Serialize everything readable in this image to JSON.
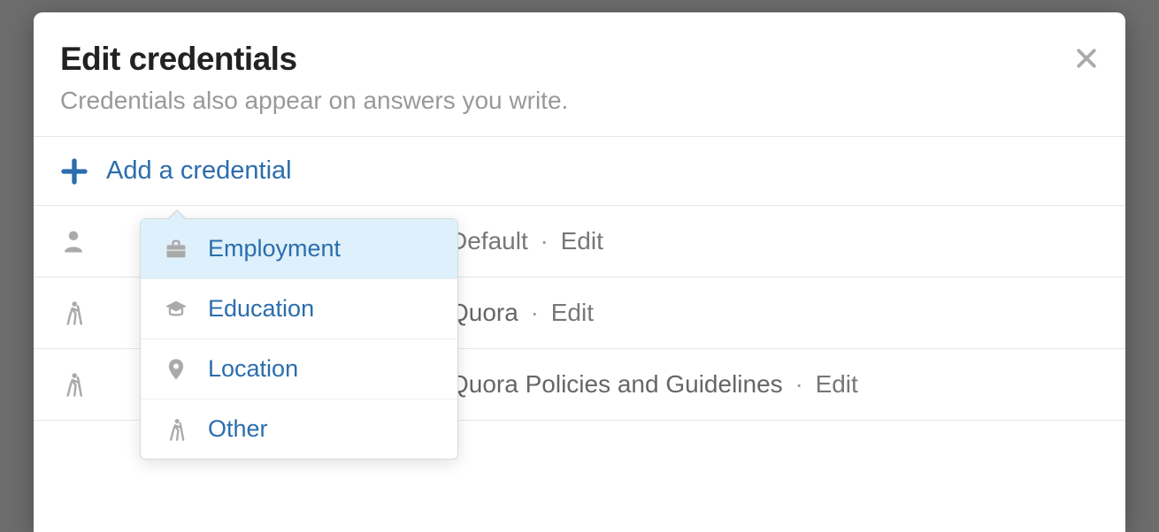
{
  "modal": {
    "title": "Edit credentials",
    "subtitle": "Credentials also appear on answers you write.",
    "add_label": "Add a credential"
  },
  "dropdown": {
    "items": [
      {
        "label": "Employment",
        "icon": "briefcase-icon",
        "selected": true
      },
      {
        "label": "Education",
        "icon": "graduation-cap-icon",
        "selected": false
      },
      {
        "label": "Location",
        "icon": "map-pin-icon",
        "selected": false
      },
      {
        "label": "Other",
        "icon": "walking-person-icon",
        "selected": false
      }
    ]
  },
  "credentials": [
    {
      "icon": "person-icon",
      "text": "",
      "badge": "Default",
      "edit": "Edit"
    },
    {
      "icon": "walking-person-icon",
      "text": "Quora",
      "badge": "",
      "edit": "Edit"
    },
    {
      "icon": "walking-person-icon",
      "text": "Quora Policies and Guidelines",
      "badge": "",
      "edit": "Edit"
    }
  ]
}
